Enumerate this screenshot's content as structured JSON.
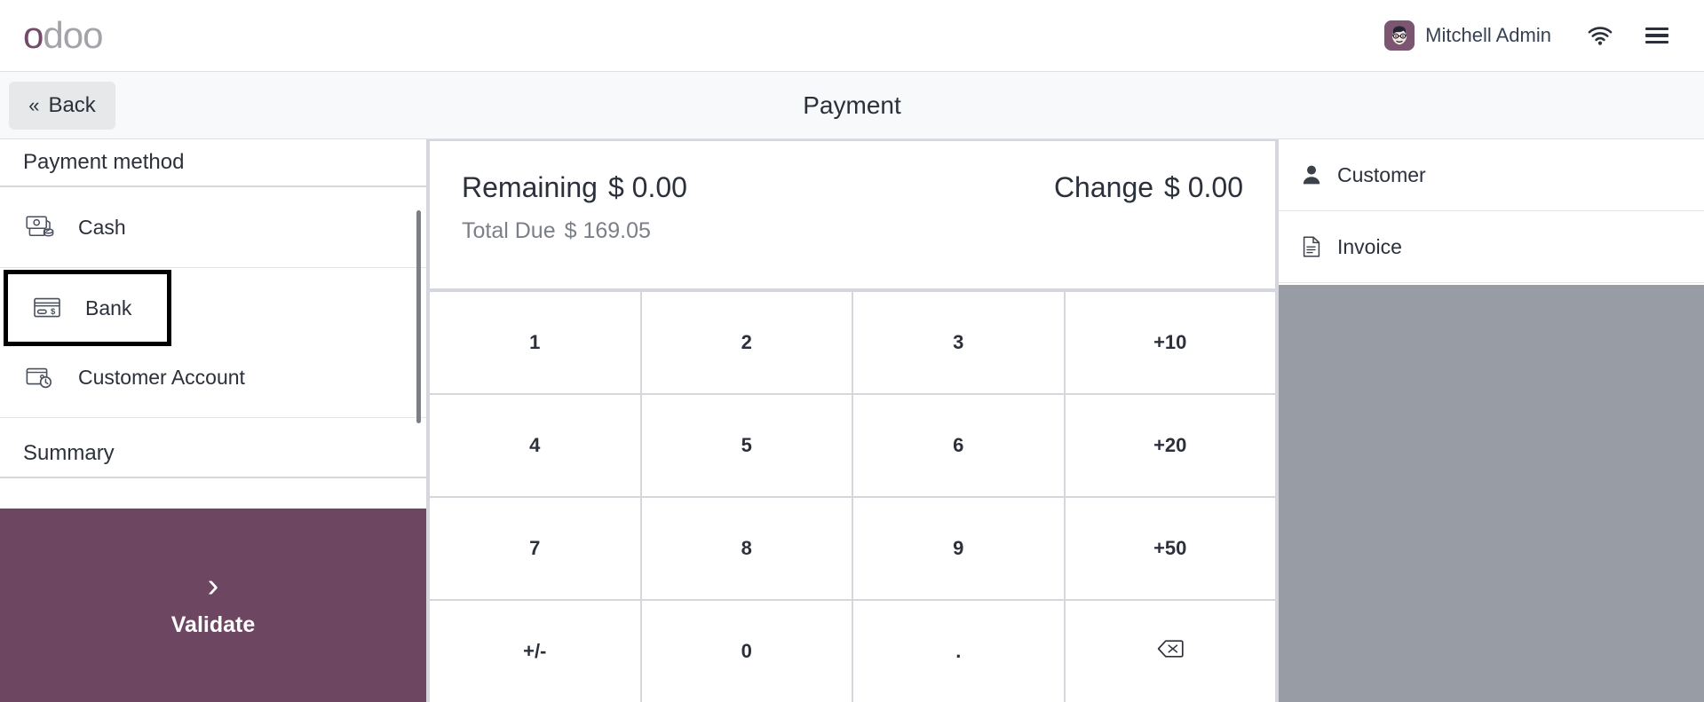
{
  "navbar": {
    "brand_first": "o",
    "brand_rest": "doo",
    "user_name": "Mitchell Admin",
    "avatar_icon": "user-avatar",
    "wifi_icon": "wifi-icon",
    "menu_icon": "hamburger-menu-icon"
  },
  "subheader": {
    "back_label": "Back",
    "back_chevron": "«",
    "title": "Payment"
  },
  "left": {
    "payment_method_header": "Payment method",
    "methods": [
      {
        "label": "Cash",
        "icon": "cash-icon",
        "focused": false
      },
      {
        "label": "Bank",
        "icon": "credit-card-icon",
        "focused": true
      },
      {
        "label": "Customer Account",
        "icon": "wallet-clock-icon",
        "focused": false
      }
    ],
    "summary_header": "Summary",
    "validate_label": "Validate",
    "validate_chevron": "›",
    "validate_color": "#6d4762"
  },
  "center": {
    "remaining_label": "Remaining",
    "remaining_value": "$ 0.00",
    "change_label": "Change",
    "change_value": "$ 0.00",
    "total_due_label": "Total Due",
    "total_due_value": "$ 169.05",
    "numpad": [
      {
        "label": "1",
        "name": "key-1"
      },
      {
        "label": "2",
        "name": "key-2"
      },
      {
        "label": "3",
        "name": "key-3"
      },
      {
        "label": "+10",
        "name": "key-plus-10"
      },
      {
        "label": "4",
        "name": "key-4"
      },
      {
        "label": "5",
        "name": "key-5"
      },
      {
        "label": "6",
        "name": "key-6"
      },
      {
        "label": "+20",
        "name": "key-plus-20"
      },
      {
        "label": "7",
        "name": "key-7"
      },
      {
        "label": "8",
        "name": "key-8"
      },
      {
        "label": "9",
        "name": "key-9"
      },
      {
        "label": "+50",
        "name": "key-plus-50"
      },
      {
        "label": "+/-",
        "name": "key-sign-toggle"
      },
      {
        "label": "0",
        "name": "key-0"
      },
      {
        "label": ".",
        "name": "key-decimal"
      },
      {
        "label": "",
        "name": "key-backspace",
        "icon": "backspace-icon"
      }
    ]
  },
  "right": {
    "items": [
      {
        "label": "Customer",
        "icon": "person-icon"
      },
      {
        "label": "Invoice",
        "icon": "document-icon"
      }
    ]
  }
}
